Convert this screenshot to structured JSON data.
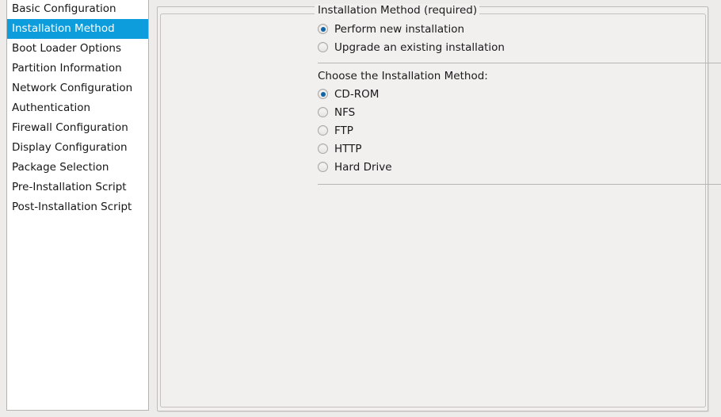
{
  "sidebar": {
    "items": [
      {
        "label": "Basic Configuration",
        "selected": false
      },
      {
        "label": "Installation Method",
        "selected": true
      },
      {
        "label": "Boot Loader Options",
        "selected": false
      },
      {
        "label": "Partition Information",
        "selected": false
      },
      {
        "label": "Network Configuration",
        "selected": false
      },
      {
        "label": "Authentication",
        "selected": false
      },
      {
        "label": "Firewall Configuration",
        "selected": false
      },
      {
        "label": "Display Configuration",
        "selected": false
      },
      {
        "label": "Package Selection",
        "selected": false
      },
      {
        "label": "Pre-Installation Script",
        "selected": false
      },
      {
        "label": "Post-Installation Script",
        "selected": false
      }
    ],
    "selected_label": "Installation Method",
    "selection_color": "#0d9ddd"
  },
  "panel": {
    "group_legend": "Installation Method (required)",
    "install_type": {
      "options": [
        {
          "label": "Perform new installation",
          "selected": true
        },
        {
          "label": "Upgrade an existing installation",
          "selected": false
        }
      ]
    },
    "method_section": {
      "title": "Choose the Installation Method:",
      "options": [
        {
          "label": "CD-ROM",
          "selected": true
        },
        {
          "label": "NFS",
          "selected": false
        },
        {
          "label": "FTP",
          "selected": false
        },
        {
          "label": "HTTP",
          "selected": false
        },
        {
          "label": "Hard Drive",
          "selected": false
        }
      ]
    }
  },
  "theme": {
    "background": "#edeceb",
    "panel_bg": "#f1f0ef",
    "list_bg": "#ffffff",
    "accent": "#0d9ddd",
    "radio_dot": "#1064a8",
    "border": "#bfbcb9"
  }
}
